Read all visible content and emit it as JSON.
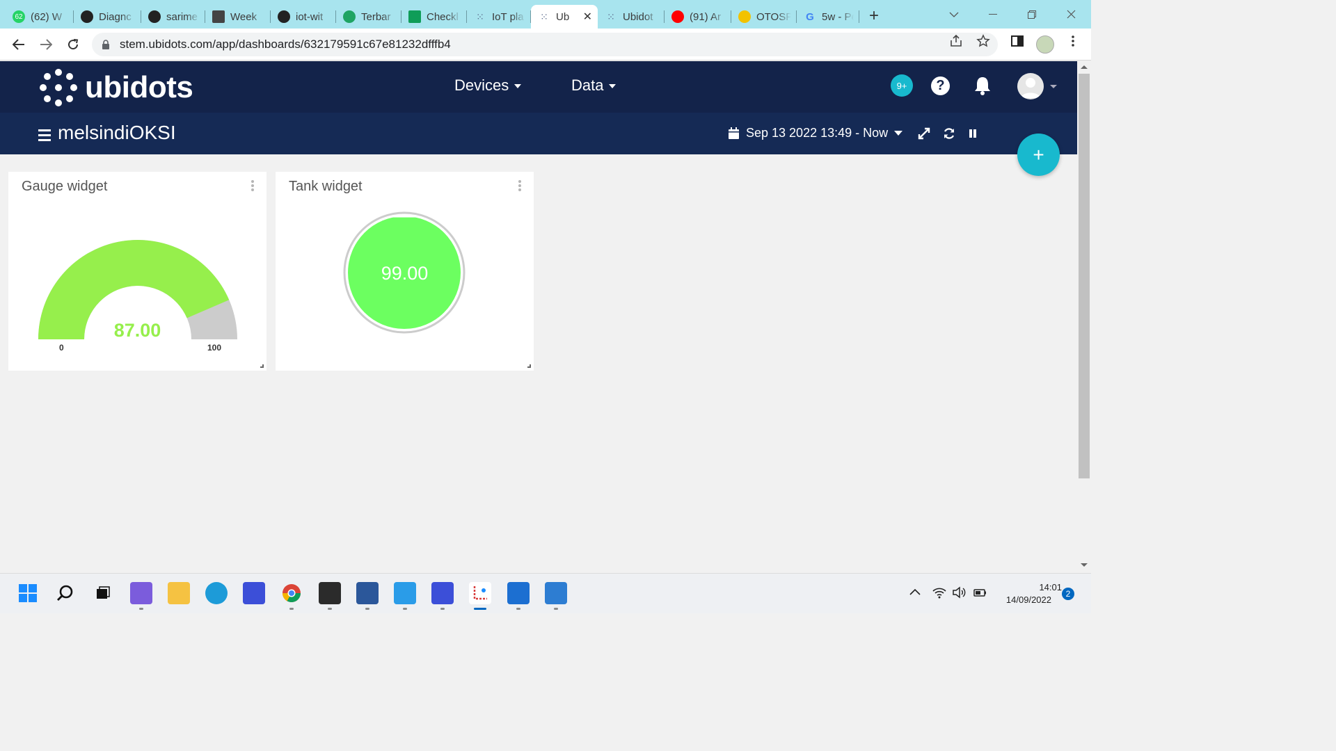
{
  "browser": {
    "tabs": [
      {
        "label": "(62) W",
        "icon": "whatsapp-icon",
        "color": "#25d366",
        "glyph": "62"
      },
      {
        "label": "Diagnc",
        "icon": "github-icon",
        "color": "#222222",
        "glyph": ""
      },
      {
        "label": "sarime",
        "icon": "github-icon",
        "color": "#222222",
        "glyph": ""
      },
      {
        "label": "Week",
        "icon": "classroom-icon",
        "color": "#444444",
        "glyph": ""
      },
      {
        "label": "iot-wit",
        "icon": "github-icon",
        "color": "#222222",
        "glyph": ""
      },
      {
        "label": "Terbar",
        "icon": "google-drive-icon",
        "color": "#1fa463",
        "glyph": ""
      },
      {
        "label": "Checkl",
        "icon": "google-sheets-icon",
        "color": "#0f9d58",
        "glyph": ""
      },
      {
        "label": "IoT pla",
        "icon": "ubidots-icon",
        "color": "#5b6b8c",
        "glyph": ""
      },
      {
        "label": "Ub",
        "icon": "ubidots-icon",
        "color": "#5b6b8c",
        "glyph": "",
        "active": true
      },
      {
        "label": "Ubidot",
        "icon": "ubidots-icon",
        "color": "#5b6b8c",
        "glyph": ""
      },
      {
        "label": "(91) Ar",
        "icon": "youtube-icon",
        "color": "#ff0000",
        "glyph": ""
      },
      {
        "label": "OTOSP",
        "icon": "otosp-icon",
        "color": "#f2c200",
        "glyph": ""
      },
      {
        "label": "5w - Pe",
        "icon": "google-icon",
        "color": "#4285f4",
        "glyph": "G"
      }
    ],
    "url": "stem.ubidots.com/app/dashboards/632179591c67e81232dfffb4"
  },
  "header": {
    "logo_text": "ubidots",
    "menu": [
      {
        "label": "Devices"
      },
      {
        "label": "Data"
      }
    ],
    "notifications_badge": "9+",
    "help_label": "?"
  },
  "dashboard": {
    "title": "melsindiOKSI",
    "date_range": "Sep 13 2022 13:49 - Now",
    "add_label": "+"
  },
  "widgets": {
    "gauge": {
      "title": "Gauge widget",
      "value_text": "87.00",
      "value": 87,
      "min_label": "0",
      "max_label": "100",
      "fill_color": "#96ef4c",
      "empty_color": "#cccccc"
    },
    "tank": {
      "title": "Tank widget",
      "value_text": "99.00",
      "value": 99,
      "fill_color": "#6cff60",
      "ring_color": "#cccccc"
    }
  },
  "taskbar": {
    "apps": [
      {
        "icon": "windows-start-icon"
      },
      {
        "icon": "search-icon"
      },
      {
        "icon": "task-view-icon"
      },
      {
        "icon": "teams-chat-icon"
      },
      {
        "icon": "file-explorer-icon"
      },
      {
        "icon": "edge-icon"
      },
      {
        "icon": "app-icon"
      },
      {
        "icon": "chrome-icon"
      },
      {
        "icon": "terminal-icon"
      },
      {
        "icon": "word-icon"
      },
      {
        "icon": "vscode-icon"
      },
      {
        "icon": "app-icon"
      },
      {
        "icon": "snipping-tool-icon"
      },
      {
        "icon": "media-player-icon"
      },
      {
        "icon": "photos-icon"
      }
    ],
    "clock_time": "14:01",
    "clock_date": "14/09/2022",
    "notification_count": "2"
  }
}
